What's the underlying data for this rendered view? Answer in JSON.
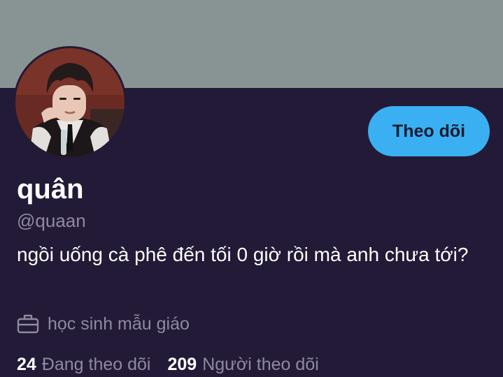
{
  "profile": {
    "display_name": "quân",
    "handle": "@quaan",
    "bio": "ngồi uống cà phê đến tối 0 giờ rồi mà anh chưa tới?",
    "job": "học sinh mẫu giáo",
    "follow_label": "Theo dõi",
    "avatar_icon": "profile-photo",
    "job_icon": "briefcase-icon"
  },
  "stats": {
    "following_count": "24",
    "following_label": "Đang theo dõi",
    "followers_count": "209",
    "followers_label": "Người theo dõi"
  },
  "colors": {
    "banner": "#889494",
    "background": "#221a36",
    "accent": "#3ab0f2",
    "muted_text": "#8e8aa0"
  }
}
